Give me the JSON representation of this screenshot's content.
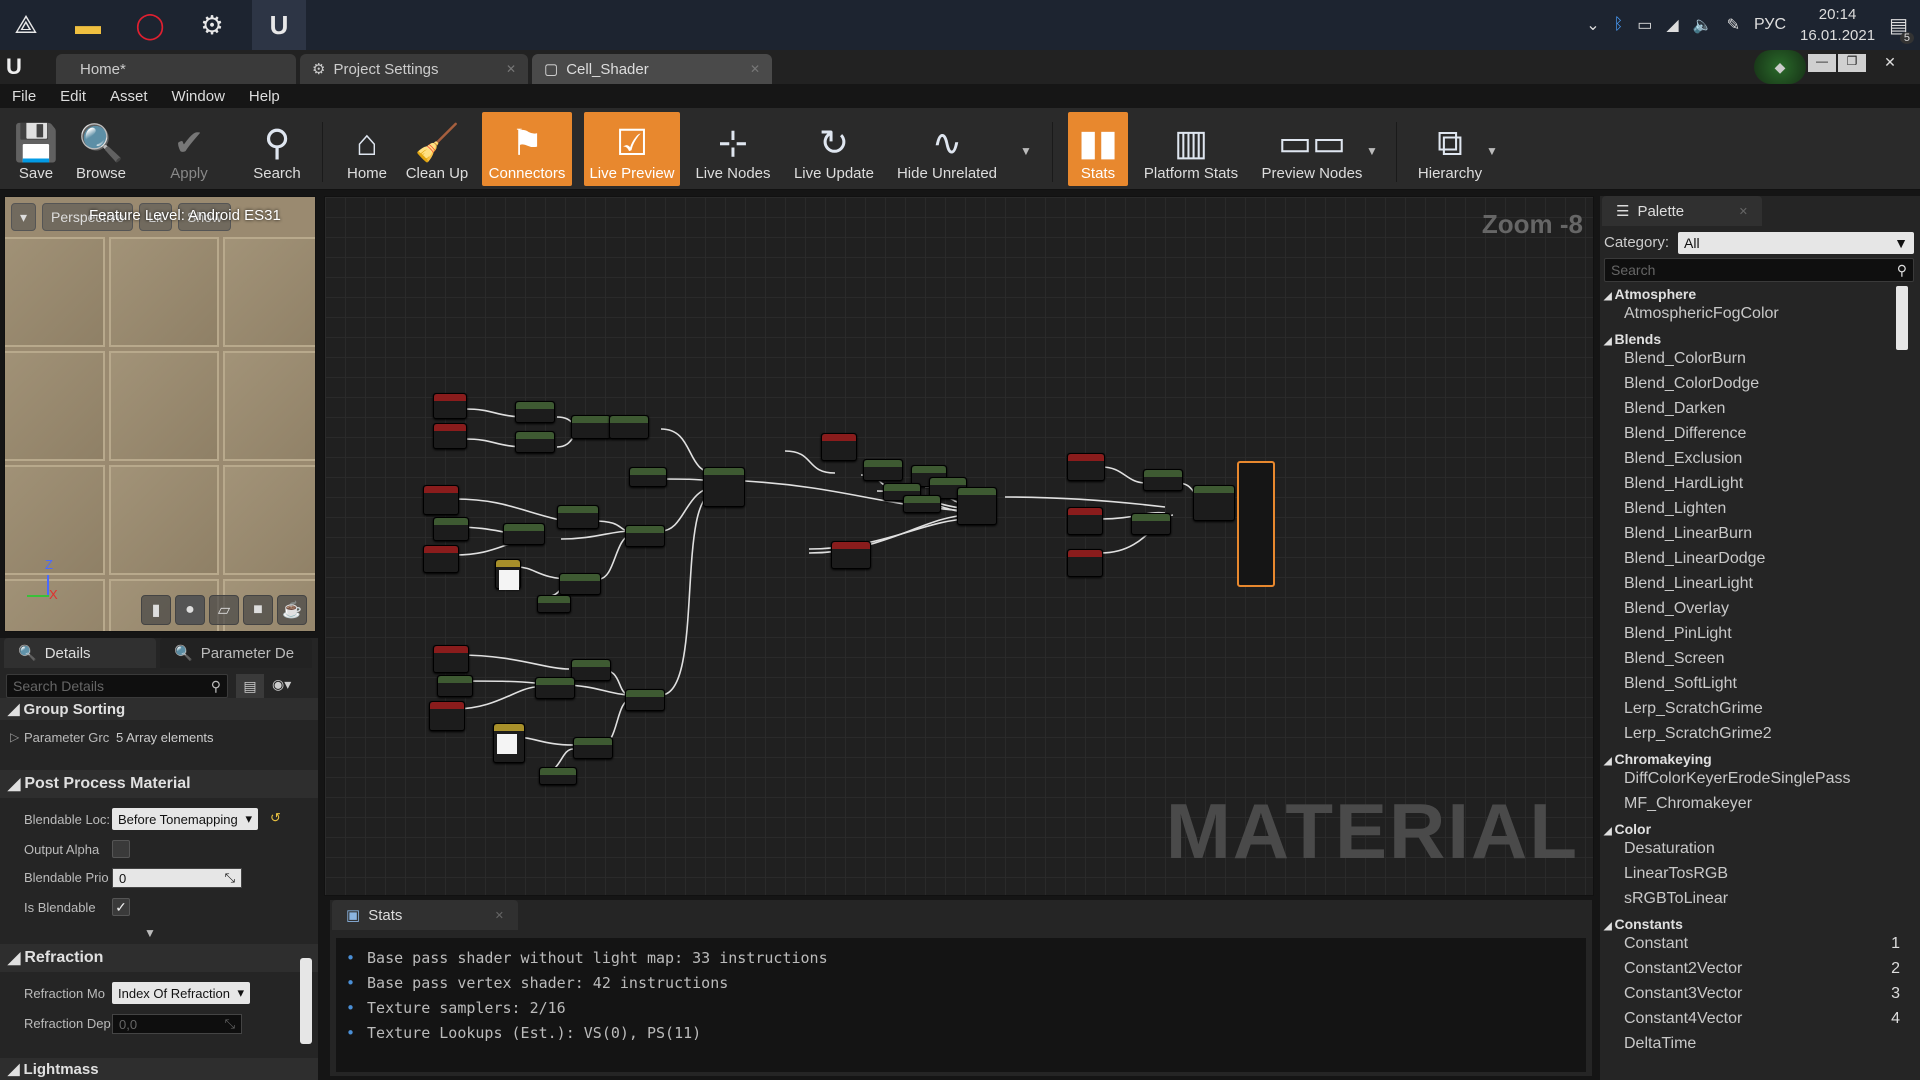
{
  "taskbar": {
    "tray_lang": "РУС",
    "time": "20:14",
    "date": "16.01.2021",
    "notification_count": "5"
  },
  "editor_tabs": [
    {
      "label": "Home*"
    },
    {
      "label": "Project Settings"
    },
    {
      "label": "Cell_Shader"
    }
  ],
  "menu": [
    "File",
    "Edit",
    "Asset",
    "Window",
    "Help"
  ],
  "toolbar": {
    "save": "Save",
    "browse": "Browse",
    "apply": "Apply",
    "search": "Search",
    "home": "Home",
    "clean_up": "Clean Up",
    "connectors": "Connectors",
    "live_preview": "Live Preview",
    "live_nodes": "Live Nodes",
    "live_update": "Live Update",
    "hide_unrelated": "Hide Unrelated",
    "stats": "Stats",
    "platform_stats": "Platform Stats",
    "preview_nodes": "Preview Nodes",
    "hierarchy": "Hierarchy"
  },
  "viewport": {
    "perspective": "Perspective",
    "lit": "Lit",
    "show": "Show",
    "feature_level": "Feature Level: Android ES31",
    "axis_z": "Z",
    "axis_x": "X"
  },
  "details": {
    "tab_details": "Details",
    "tab_param": "Parameter De",
    "search_placeholder": "Search Details",
    "group_sorting": "Group Sorting",
    "param_groups_label": "Parameter Grc",
    "param_groups_value": "5 Array elements",
    "post_process": "Post Process Material",
    "blendable_location_label": "Blendable Loc:",
    "blendable_location_value": "Before Tonemapping",
    "output_alpha_label": "Output Alpha",
    "blendable_priority_label": "Blendable Prio",
    "blendable_priority_value": "0",
    "is_blendable_label": "Is Blendable",
    "refraction": "Refraction",
    "refraction_mode_label": "Refraction Mo",
    "refraction_mode_value": "Index Of Refraction",
    "refraction_depth_label": "Refraction Dep",
    "refraction_depth_value": "0,0",
    "lightmass": "Lightmass"
  },
  "graph": {
    "zoom": "Zoom -8",
    "watermark": "MATERIAL"
  },
  "stats": {
    "tab": "Stats",
    "lines": [
      "Base pass shader without light map: 33 instructions",
      "Base pass vertex shader: 42 instructions",
      "Texture samplers: 2/16",
      "Texture Lookups (Est.): VS(0), PS(11)"
    ]
  },
  "palette": {
    "tab": "Palette",
    "category_label": "Category:",
    "category_value": "All",
    "search_placeholder": "Search",
    "groups": [
      {
        "name": "Atmosphere",
        "items": [
          {
            "label": "AtmosphericFogColor"
          }
        ]
      },
      {
        "name": "Blends",
        "items": [
          {
            "label": "Blend_ColorBurn"
          },
          {
            "label": "Blend_ColorDodge"
          },
          {
            "label": "Blend_Darken"
          },
          {
            "label": "Blend_Difference"
          },
          {
            "label": "Blend_Exclusion"
          },
          {
            "label": "Blend_HardLight"
          },
          {
            "label": "Blend_Lighten"
          },
          {
            "label": "Blend_LinearBurn"
          },
          {
            "label": "Blend_LinearDodge"
          },
          {
            "label": "Blend_LinearLight"
          },
          {
            "label": "Blend_Overlay"
          },
          {
            "label": "Blend_PinLight"
          },
          {
            "label": "Blend_Screen"
          },
          {
            "label": "Blend_SoftLight"
          },
          {
            "label": "Lerp_ScratchGrime"
          },
          {
            "label": "Lerp_ScratchGrime2"
          }
        ]
      },
      {
        "name": "Chromakeying",
        "items": [
          {
            "label": "DiffColorKeyerErodeSinglePass"
          },
          {
            "label": "MF_Chromakeyer"
          }
        ]
      },
      {
        "name": "Color",
        "items": [
          {
            "label": "Desaturation"
          },
          {
            "label": "LinearTosRGB"
          },
          {
            "label": "sRGBToLinear"
          }
        ]
      },
      {
        "name": "Constants",
        "items": [
          {
            "label": "Constant",
            "hotkey": "1"
          },
          {
            "label": "Constant2Vector",
            "hotkey": "2"
          },
          {
            "label": "Constant3Vector",
            "hotkey": "3"
          },
          {
            "label": "Constant4Vector",
            "hotkey": "4"
          },
          {
            "label": "DeltaTime"
          }
        ]
      }
    ]
  },
  "colors": {
    "accent_orange": "#e8882e",
    "node_red": "#8a1c1c",
    "node_green": "#3e5a32",
    "stat_bullet": "#4a8fd6"
  }
}
